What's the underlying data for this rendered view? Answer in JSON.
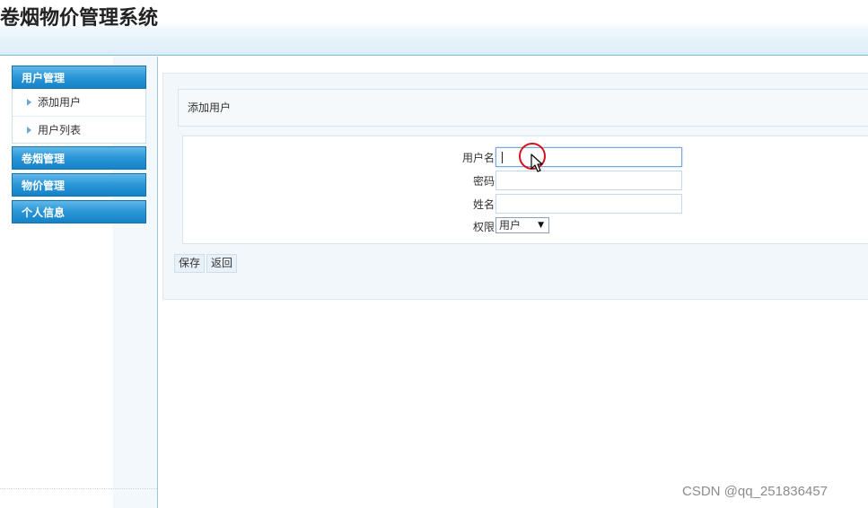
{
  "app": {
    "title": "卷烟物价管理系统"
  },
  "sidebar": {
    "groups": [
      {
        "label": "用户管理",
        "items": [
          {
            "label": "添加用户"
          },
          {
            "label": "用户列表"
          }
        ]
      },
      {
        "label": "卷烟管理",
        "items": []
      },
      {
        "label": "物价管理",
        "items": []
      },
      {
        "label": "个人信息",
        "items": []
      }
    ]
  },
  "main": {
    "breadcrumb": "添加用户",
    "form": {
      "username": {
        "label": "用户名",
        "value": ""
      },
      "password": {
        "label": "密码",
        "value": ""
      },
      "name": {
        "label": "姓名",
        "value": ""
      },
      "role": {
        "label": "权限",
        "selected": "用户"
      }
    },
    "buttons": {
      "save": "保存",
      "back": "返回"
    }
  },
  "watermark": "CSDN @qq_251836457",
  "colors": {
    "menu_header": "#2a95d6",
    "cursor_ring": "#d3121c",
    "header_border": "#7fb9d9"
  }
}
